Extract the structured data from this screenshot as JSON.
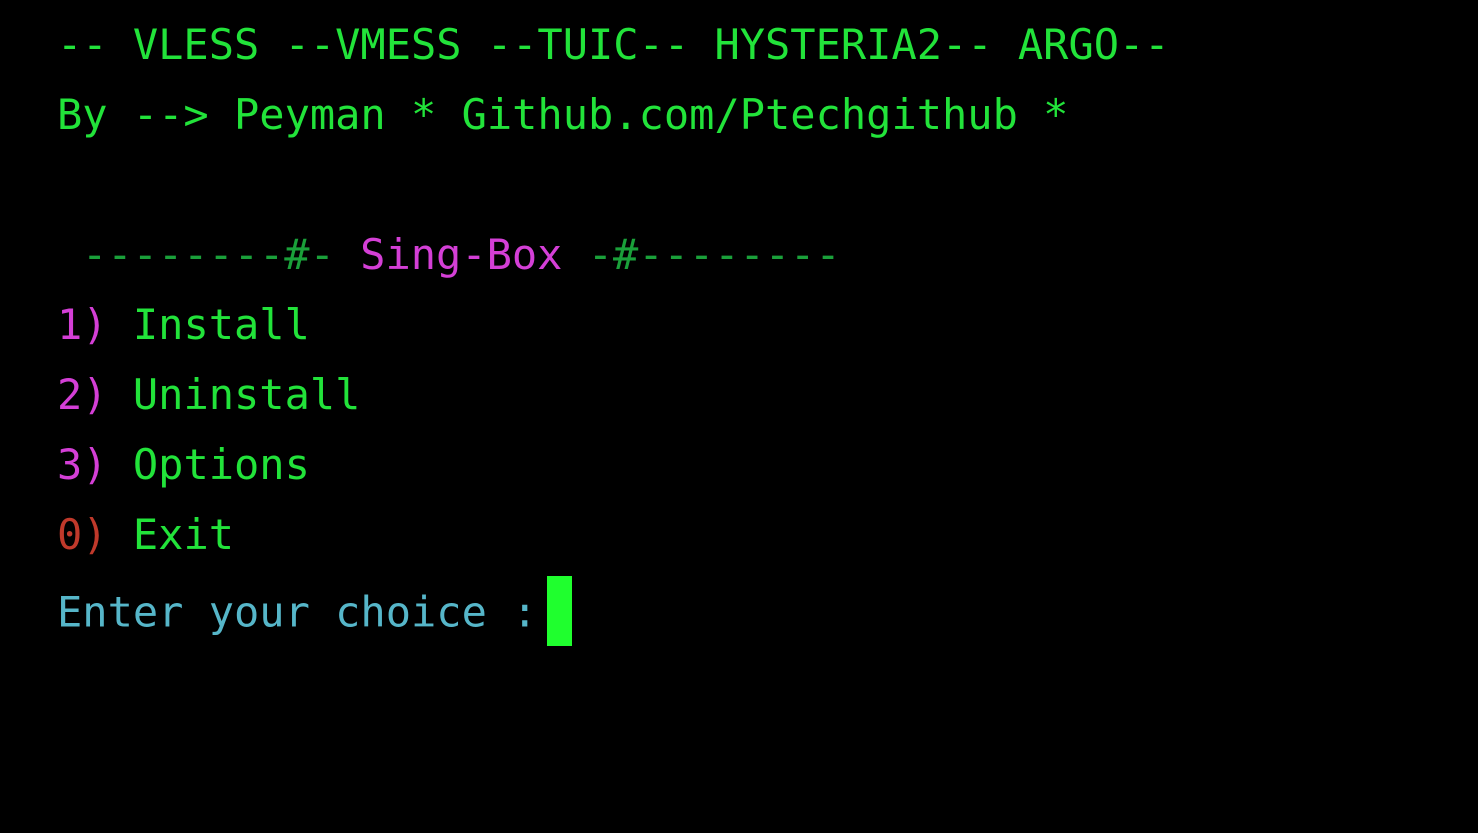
{
  "terminal": {
    "banner": {
      "protocols": "-- VLESS --VMESS --TUIC-- HYSTERIA2-- ARGO--",
      "author": "By --> Peyman * Github.com/Ptechgithub *"
    },
    "menu_header": {
      "left_rule": "--------#-",
      "title": "Sing-Box",
      "right_rule": "-#--------"
    },
    "menu_items": [
      {
        "key": "1)",
        "label": "Install"
      },
      {
        "key": "2)",
        "label": "Uninstall"
      },
      {
        "key": "3)",
        "label": "Options"
      },
      {
        "key": "0)",
        "label": "Exit"
      }
    ],
    "prompt": "Enter your choice :",
    "colors": {
      "background": "#000000",
      "text_green": "#22e33a",
      "key_magenta": "#d43fd6",
      "key_exit_red": "#c0392b",
      "prompt_cyan": "#56b6c9",
      "cursor": "#1fff2e"
    }
  }
}
